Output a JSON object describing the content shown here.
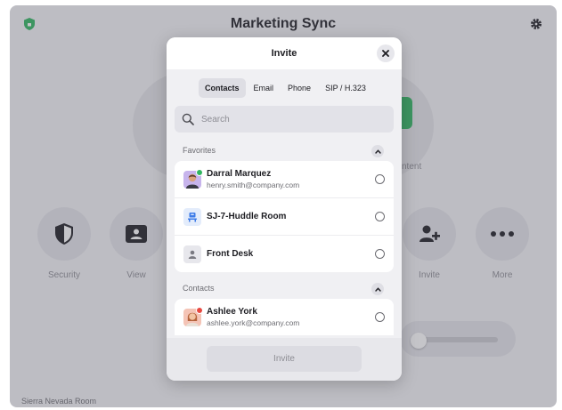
{
  "app": {
    "title": "Marketing Sync",
    "room_name": "Sierra Nevada Room"
  },
  "background_controls": [
    {
      "label": "Security",
      "icon": "shield-icon"
    },
    {
      "label": "View",
      "icon": "view-icon"
    },
    {
      "label": "Invite",
      "icon": "add-person-icon"
    },
    {
      "label": "More",
      "icon": "ellipsis-icon"
    }
  ],
  "background_partial_text": "ntent",
  "invite_modal": {
    "title": "Invite",
    "close_icon": "close-icon",
    "tabs": [
      {
        "label": "Contacts",
        "active": true
      },
      {
        "label": "Email",
        "active": false
      },
      {
        "label": "Phone",
        "active": false
      },
      {
        "label": "SIP / H.323",
        "active": false
      }
    ],
    "search": {
      "placeholder": "Search",
      "value": ""
    },
    "favorites": {
      "label": "Favorites",
      "items": [
        {
          "name": "Darral Marquez",
          "email": "henry.smith@company.com",
          "avatar": "person-photo",
          "presence": "#2fb560"
        },
        {
          "name": "SJ-7-Huddle Room",
          "email": "",
          "avatar": "room-icon"
        },
        {
          "name": "Front Desk",
          "email": "",
          "avatar": "person-icon"
        }
      ]
    },
    "contacts": {
      "label": "Contacts",
      "items": [
        {
          "name": "Ashlee York",
          "email": "ashlee.york@company.com",
          "avatar": "person-photo",
          "presence": "#e8473f"
        }
      ]
    },
    "invite_button_label": "Invite"
  },
  "colors": {
    "accent_green": "#2fb560",
    "room_icon_blue": "#3d7be8",
    "busy_red": "#e8473f"
  }
}
